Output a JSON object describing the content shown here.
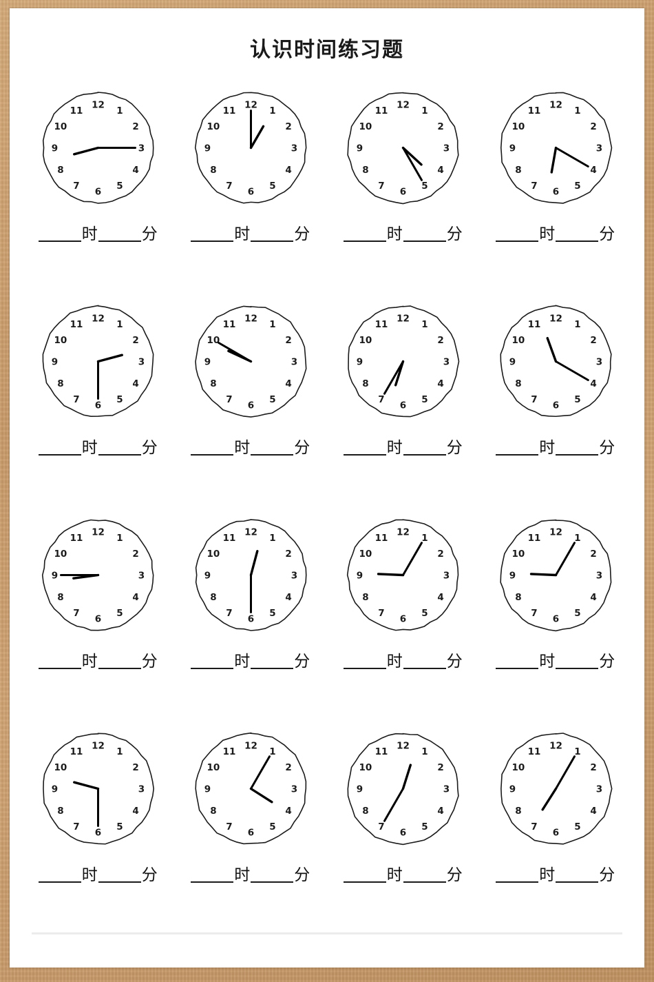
{
  "page": {
    "title": "认识时间练习题",
    "background_color": "#c69c6d",
    "sheet_color": "#ffffff",
    "ink_color": "#1a1a1a",
    "divider_color": "#ececec"
  },
  "answer_line": {
    "hour_unit": "时",
    "minute_unit": "分",
    "blank_placeholder": "_____",
    "full_text": "_____时_____分"
  },
  "clock_face": {
    "hour_labels": [
      "12",
      "1",
      "2",
      "3",
      "4",
      "5",
      "6",
      "7",
      "8",
      "9",
      "10",
      "11"
    ],
    "outline_color": "#1b1b1b",
    "hand_color": "#000000"
  },
  "problems": [
    {
      "index": 1,
      "hour": 8,
      "minute": 15,
      "time": "8:15",
      "hour_angle": 255.0,
      "minute_angle": 90
    },
    {
      "index": 2,
      "hour": 1,
      "minute": 0,
      "time": "1:00",
      "hour_angle": 30.0,
      "minute_angle": 0
    },
    {
      "index": 3,
      "hour": 4,
      "minute": 25,
      "time": "4:25",
      "hour_angle": 132.5,
      "minute_angle": 150
    },
    {
      "index": 4,
      "hour": 6,
      "minute": 20,
      "time": "6:20",
      "hour_angle": 190.0,
      "minute_angle": 120
    },
    {
      "index": 5,
      "hour": 2,
      "minute": 30,
      "time": "2:30",
      "hour_angle": 75.0,
      "minute_angle": 180
    },
    {
      "index": 6,
      "hour": 9,
      "minute": 50,
      "time": "9:50",
      "hour_angle": 295.0,
      "minute_angle": 300
    },
    {
      "index": 7,
      "hour": 6,
      "minute": 35,
      "time": "6:35",
      "hour_angle": 197.5,
      "minute_angle": 210
    },
    {
      "index": 8,
      "hour": 11,
      "minute": 20,
      "time": "11:20",
      "hour_angle": 340.0,
      "minute_angle": 120
    },
    {
      "index": 9,
      "hour": 8,
      "minute": 45,
      "time": "8:45",
      "hour_angle": 262.5,
      "minute_angle": 270
    },
    {
      "index": 10,
      "hour": 12,
      "minute": 30,
      "time": "12:30",
      "hour_angle": 15.0,
      "minute_angle": 180
    },
    {
      "index": 11,
      "hour": 9,
      "minute": 5,
      "time": "9:05",
      "hour_angle": 272.5,
      "minute_angle": 30
    },
    {
      "index": 12,
      "hour": 9,
      "minute": 5,
      "time": "9:05",
      "hour_angle": 272.5,
      "minute_angle": 30
    },
    {
      "index": 13,
      "hour": 9,
      "minute": 30,
      "time": "9:30",
      "hour_angle": 285.0,
      "minute_angle": 180
    },
    {
      "index": 14,
      "hour": 4,
      "minute": 5,
      "time": "4:05",
      "hour_angle": 122.5,
      "minute_angle": 30
    },
    {
      "index": 15,
      "hour": 12,
      "minute": 35,
      "time": "12:35",
      "hour_angle": 17.5,
      "minute_angle": 210
    },
    {
      "index": 16,
      "hour": 7,
      "minute": 5,
      "time": "7:05",
      "hour_angle": 212.5,
      "minute_angle": 30
    }
  ]
}
